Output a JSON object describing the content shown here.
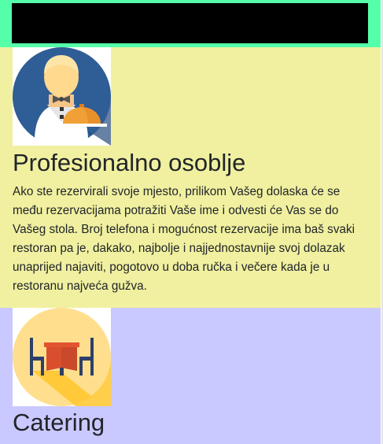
{
  "header": {
    "bar_color": "#000000",
    "band_color": "#55ffa9"
  },
  "sections": [
    {
      "id": "staff",
      "icon": "waiter-icon",
      "background": "#f0f0a0",
      "title": "Profesionalno osoblje",
      "text": "Ako ste rezervirali svoje mjesto, prilikom Vašeg dolaska će se među rezervacijama potražiti Vaše ime i odvesti će Vas se do Vašeg stola. Broj telefona i mogućnost rezervacije ima baš svaki restoran pa je, dakako, najbolje i najjednostavnije svoj dolazak unaprijed najaviti, pogotovo u doba ručka i večere kada je u restoranu najveća gužva."
    },
    {
      "id": "catering",
      "icon": "dining-table-icon",
      "background": "#c9c9ff",
      "title": "Catering"
    }
  ]
}
